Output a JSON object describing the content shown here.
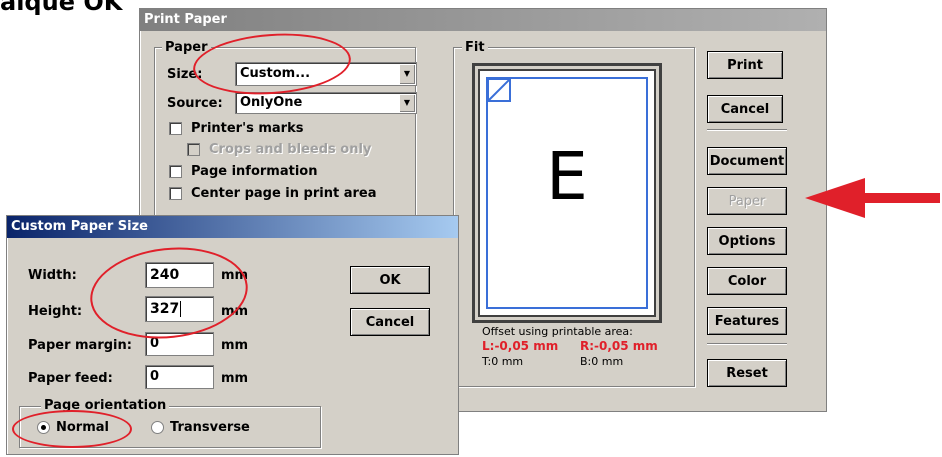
{
  "heading_fragment": "aique OK",
  "print_dialog": {
    "title": "Print Paper",
    "paper_group": {
      "label": "Paper",
      "size_label": "Size:",
      "size_value": "Custom...",
      "source_label": "Source:",
      "source_value": "OnlyOne",
      "printers_marks": "Printer's marks",
      "crops_bleeds": "Crops and bleeds only",
      "page_information": "Page information",
      "center_page": "Center page in print area"
    },
    "fit_group": {
      "label": "Fit",
      "preview_letter": "E",
      "offset_label": "Offset using printable area:",
      "offset_left": "L:-0,05 mm",
      "offset_right": "R:-0,05 mm",
      "offset_top": "T:0 mm",
      "offset_bottom": "B:0 mm"
    },
    "buttons": {
      "print": "Print",
      "cancel": "Cancel",
      "document": "Document",
      "paper": "Paper",
      "options": "Options",
      "color": "Color",
      "features": "Features",
      "reset": "Reset"
    }
  },
  "custom_dialog": {
    "title": "Custom Paper Size",
    "width_label": "Width:",
    "width_value": "240",
    "height_label": "Height:",
    "height_value": "327",
    "margin_label": "Paper margin:",
    "margin_value": "0",
    "feed_label": "Paper feed:",
    "feed_value": "0",
    "unit": "mm",
    "ok": "OK",
    "cancel": "Cancel",
    "orientation_label": "Page orientation",
    "normal": "Normal",
    "transverse": "Transverse"
  },
  "colors": {
    "annotation_red": "#e0202a",
    "title_blue": "#0a246a"
  }
}
